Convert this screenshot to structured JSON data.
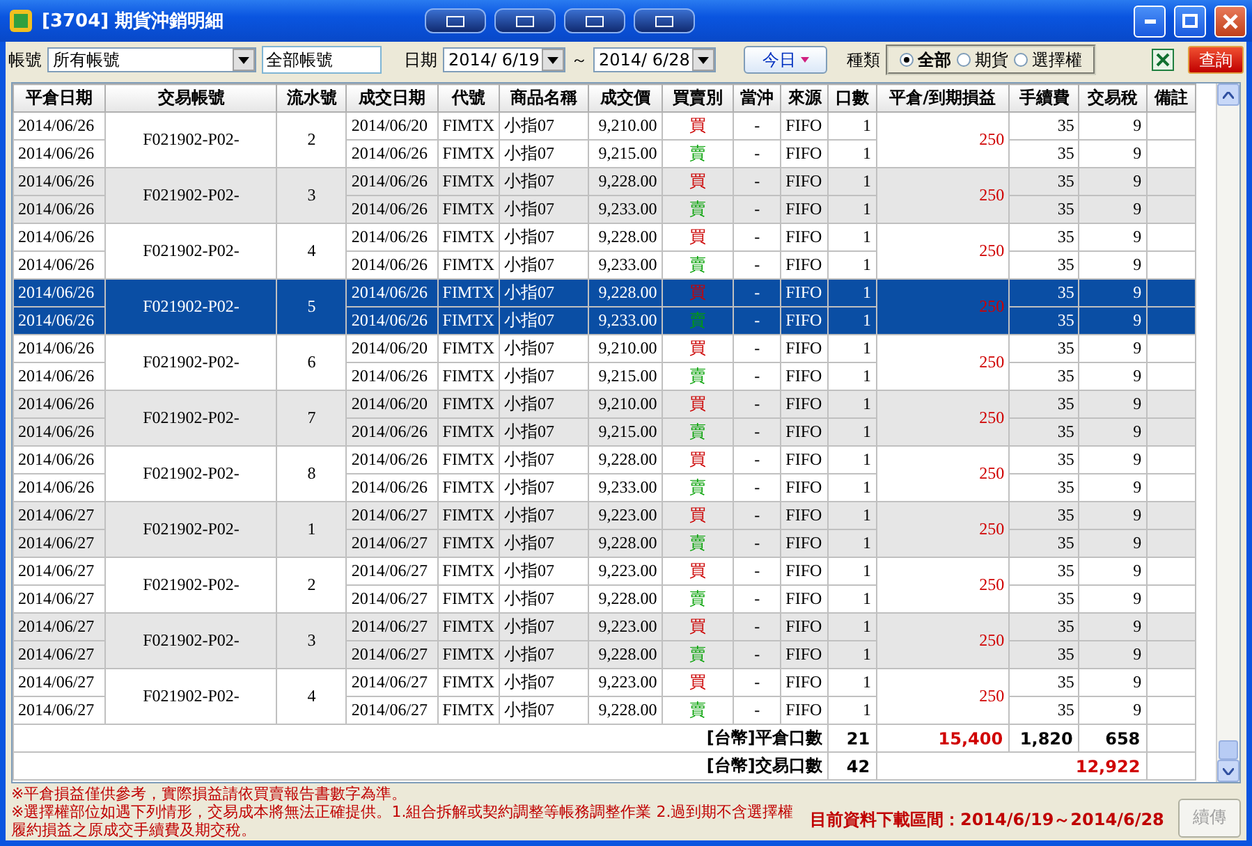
{
  "window": {
    "title": "[3704] 期貨沖銷明細"
  },
  "toolbar": {
    "account_label": "帳號",
    "account_select": "所有帳號",
    "account_field": "全部帳號",
    "date_label": "日期",
    "date_from": "2014/ 6/19",
    "range_sep": "～",
    "date_to": "2014/ 6/28",
    "today_button": "今日",
    "type_label": "種類",
    "types": [
      {
        "label": "全部",
        "selected": true
      },
      {
        "label": "期貨",
        "selected": false
      },
      {
        "label": "選擇權",
        "selected": false
      }
    ],
    "query_button": "查詢"
  },
  "table": {
    "columns": [
      "平倉日期",
      "交易帳號",
      "流水號",
      "成交日期",
      "代號",
      "商品名稱",
      "成交價",
      "買賣別",
      "當沖",
      "來源",
      "口數",
      "平倉/到期損益",
      "手續費",
      "交易稅",
      "備註"
    ],
    "groups": [
      {
        "selected": false,
        "account": "F021902-P02-",
        "serial": "2",
        "pnl": "250",
        "legs": [
          {
            "close_date": "2014/06/26",
            "trade_date": "2014/06/20",
            "code": "FIMTX",
            "product": "小指07",
            "price": "9,210.00",
            "side": "買",
            "color": "#cc0000",
            "daytrade": "-",
            "source": "FIFO",
            "qty": "1",
            "fee": "35",
            "tax": "9"
          },
          {
            "close_date": "2014/06/26",
            "trade_date": "2014/06/26",
            "code": "FIMTX",
            "product": "小指07",
            "price": "9,215.00",
            "side": "賣",
            "color": "#00a000",
            "daytrade": "-",
            "source": "FIFO",
            "qty": "1",
            "fee": "35",
            "tax": "9"
          }
        ]
      },
      {
        "selected": false,
        "account": "F021902-P02-",
        "serial": "3",
        "pnl": "250",
        "legs": [
          {
            "close_date": "2014/06/26",
            "trade_date": "2014/06/26",
            "code": "FIMTX",
            "product": "小指07",
            "price": "9,228.00",
            "side": "買",
            "color": "#cc0000",
            "daytrade": "-",
            "source": "FIFO",
            "qty": "1",
            "fee": "35",
            "tax": "9"
          },
          {
            "close_date": "2014/06/26",
            "trade_date": "2014/06/26",
            "code": "FIMTX",
            "product": "小指07",
            "price": "9,233.00",
            "side": "賣",
            "color": "#00a000",
            "daytrade": "-",
            "source": "FIFO",
            "qty": "1",
            "fee": "35",
            "tax": "9"
          }
        ]
      },
      {
        "selected": false,
        "account": "F021902-P02-",
        "serial": "4",
        "pnl": "250",
        "legs": [
          {
            "close_date": "2014/06/26",
            "trade_date": "2014/06/26",
            "code": "FIMTX",
            "product": "小指07",
            "price": "9,228.00",
            "side": "買",
            "color": "#cc0000",
            "daytrade": "-",
            "source": "FIFO",
            "qty": "1",
            "fee": "35",
            "tax": "9"
          },
          {
            "close_date": "2014/06/26",
            "trade_date": "2014/06/26",
            "code": "FIMTX",
            "product": "小指07",
            "price": "9,233.00",
            "side": "賣",
            "color": "#00a000",
            "daytrade": "-",
            "source": "FIFO",
            "qty": "1",
            "fee": "35",
            "tax": "9"
          }
        ]
      },
      {
        "selected": true,
        "account": "F021902-P02-",
        "serial": "5",
        "pnl": "250",
        "legs": [
          {
            "close_date": "2014/06/26",
            "trade_date": "2014/06/26",
            "code": "FIMTX",
            "product": "小指07",
            "price": "9,228.00",
            "side": "買",
            "color": "#cc0000",
            "daytrade": "-",
            "source": "FIFO",
            "qty": "1",
            "fee": "35",
            "tax": "9"
          },
          {
            "close_date": "2014/06/26",
            "trade_date": "2014/06/26",
            "code": "FIMTX",
            "product": "小指07",
            "price": "9,233.00",
            "side": "賣",
            "color": "#00a000",
            "daytrade": "-",
            "source": "FIFO",
            "qty": "1",
            "fee": "35",
            "tax": "9"
          }
        ]
      },
      {
        "selected": false,
        "account": "F021902-P02-",
        "serial": "6",
        "pnl": "250",
        "legs": [
          {
            "close_date": "2014/06/26",
            "trade_date": "2014/06/20",
            "code": "FIMTX",
            "product": "小指07",
            "price": "9,210.00",
            "side": "買",
            "color": "#cc0000",
            "daytrade": "-",
            "source": "FIFO",
            "qty": "1",
            "fee": "35",
            "tax": "9"
          },
          {
            "close_date": "2014/06/26",
            "trade_date": "2014/06/26",
            "code": "FIMTX",
            "product": "小指07",
            "price": "9,215.00",
            "side": "賣",
            "color": "#00a000",
            "daytrade": "-",
            "source": "FIFO",
            "qty": "1",
            "fee": "35",
            "tax": "9"
          }
        ]
      },
      {
        "selected": false,
        "account": "F021902-P02-",
        "serial": "7",
        "pnl": "250",
        "legs": [
          {
            "close_date": "2014/06/26",
            "trade_date": "2014/06/20",
            "code": "FIMTX",
            "product": "小指07",
            "price": "9,210.00",
            "side": "買",
            "color": "#cc0000",
            "daytrade": "-",
            "source": "FIFO",
            "qty": "1",
            "fee": "35",
            "tax": "9"
          },
          {
            "close_date": "2014/06/26",
            "trade_date": "2014/06/26",
            "code": "FIMTX",
            "product": "小指07",
            "price": "9,215.00",
            "side": "賣",
            "color": "#00a000",
            "daytrade": "-",
            "source": "FIFO",
            "qty": "1",
            "fee": "35",
            "tax": "9"
          }
        ]
      },
      {
        "selected": false,
        "account": "F021902-P02-",
        "serial": "8",
        "pnl": "250",
        "legs": [
          {
            "close_date": "2014/06/26",
            "trade_date": "2014/06/26",
            "code": "FIMTX",
            "product": "小指07",
            "price": "9,228.00",
            "side": "買",
            "color": "#cc0000",
            "daytrade": "-",
            "source": "FIFO",
            "qty": "1",
            "fee": "35",
            "tax": "9"
          },
          {
            "close_date": "2014/06/26",
            "trade_date": "2014/06/26",
            "code": "FIMTX",
            "product": "小指07",
            "price": "9,233.00",
            "side": "賣",
            "color": "#00a000",
            "daytrade": "-",
            "source": "FIFO",
            "qty": "1",
            "fee": "35",
            "tax": "9"
          }
        ]
      },
      {
        "selected": false,
        "account": "F021902-P02-",
        "serial": "1",
        "pnl": "250",
        "legs": [
          {
            "close_date": "2014/06/27",
            "trade_date": "2014/06/27",
            "code": "FIMTX",
            "product": "小指07",
            "price": "9,223.00",
            "side": "買",
            "color": "#cc0000",
            "daytrade": "-",
            "source": "FIFO",
            "qty": "1",
            "fee": "35",
            "tax": "9"
          },
          {
            "close_date": "2014/06/27",
            "trade_date": "2014/06/27",
            "code": "FIMTX",
            "product": "小指07",
            "price": "9,228.00",
            "side": "賣",
            "color": "#00a000",
            "daytrade": "-",
            "source": "FIFO",
            "qty": "1",
            "fee": "35",
            "tax": "9"
          }
        ]
      },
      {
        "selected": false,
        "account": "F021902-P02-",
        "serial": "2",
        "pnl": "250",
        "legs": [
          {
            "close_date": "2014/06/27",
            "trade_date": "2014/06/27",
            "code": "FIMTX",
            "product": "小指07",
            "price": "9,223.00",
            "side": "買",
            "color": "#cc0000",
            "daytrade": "-",
            "source": "FIFO",
            "qty": "1",
            "fee": "35",
            "tax": "9"
          },
          {
            "close_date": "2014/06/27",
            "trade_date": "2014/06/27",
            "code": "FIMTX",
            "product": "小指07",
            "price": "9,228.00",
            "side": "賣",
            "color": "#00a000",
            "daytrade": "-",
            "source": "FIFO",
            "qty": "1",
            "fee": "35",
            "tax": "9"
          }
        ]
      },
      {
        "selected": false,
        "account": "F021902-P02-",
        "serial": "3",
        "pnl": "250",
        "legs": [
          {
            "close_date": "2014/06/27",
            "trade_date": "2014/06/27",
            "code": "FIMTX",
            "product": "小指07",
            "price": "9,223.00",
            "side": "買",
            "color": "#cc0000",
            "daytrade": "-",
            "source": "FIFO",
            "qty": "1",
            "fee": "35",
            "tax": "9"
          },
          {
            "close_date": "2014/06/27",
            "trade_date": "2014/06/27",
            "code": "FIMTX",
            "product": "小指07",
            "price": "9,228.00",
            "side": "賣",
            "color": "#00a000",
            "daytrade": "-",
            "source": "FIFO",
            "qty": "1",
            "fee": "35",
            "tax": "9"
          }
        ]
      },
      {
        "selected": false,
        "account": "F021902-P02-",
        "serial": "4",
        "pnl": "250",
        "legs": [
          {
            "close_date": "2014/06/27",
            "trade_date": "2014/06/27",
            "code": "FIMTX",
            "product": "小指07",
            "price": "9,223.00",
            "side": "買",
            "color": "#cc0000",
            "daytrade": "-",
            "source": "FIFO",
            "qty": "1",
            "fee": "35",
            "tax": "9"
          },
          {
            "close_date": "2014/06/27",
            "trade_date": "2014/06/27",
            "code": "FIMTX",
            "product": "小指07",
            "price": "9,228.00",
            "side": "賣",
            "color": "#00a000",
            "daytrade": "-",
            "source": "FIFO",
            "qty": "1",
            "fee": "35",
            "tax": "9"
          }
        ]
      }
    ],
    "totals": [
      {
        "kind": "close",
        "label": "[台幣]平倉口數",
        "qty": "21",
        "pnl": "15,400",
        "fee": "1,820",
        "tax": "658"
      },
      {
        "kind": "trade",
        "label": "[台幣]交易口數",
        "qty": "42",
        "pnl": "12,922"
      }
    ]
  },
  "footer": {
    "notes": [
      "※平倉損益僅供參考，實際損益請依買賣報告書數字為準。",
      "※選擇權部位如遇下列情形，交易成本將無法正確提供。1.組合拆解或契約調整等帳務調整作業 2.過到期不含選擇權履約損益之原成交手續費及期交稅。"
    ],
    "range": "目前資料下載區間：2014/6/19～2014/6/28",
    "resume_button": {
      "label": "續傳",
      "disabled": true
    }
  }
}
